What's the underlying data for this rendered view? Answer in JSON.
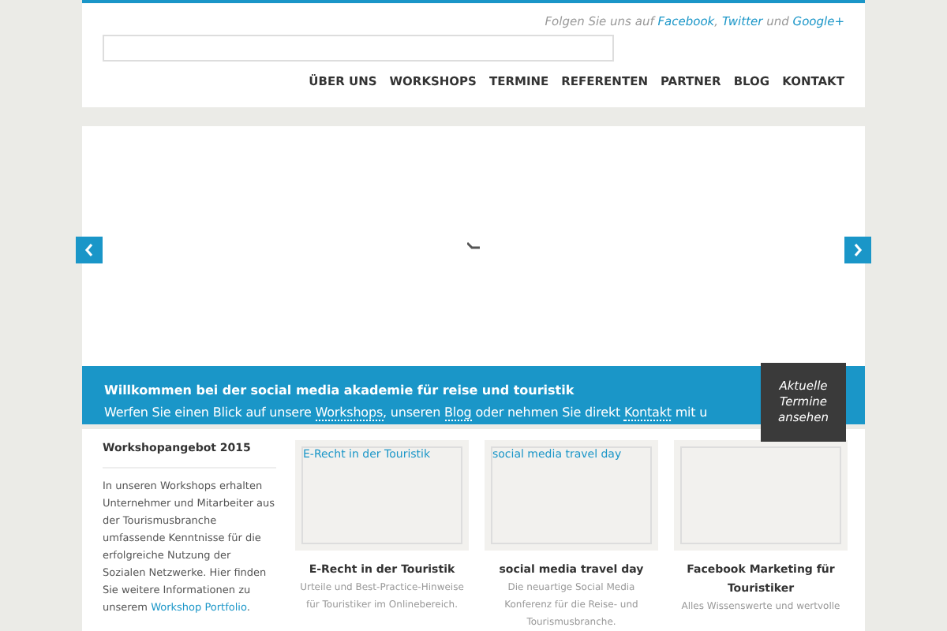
{
  "header": {
    "follow": [
      {
        "text": "Folgen Sie uns auf ",
        "link": false
      },
      {
        "text": "Facebook",
        "link": true
      },
      {
        "text": ", ",
        "link": false
      },
      {
        "text": "Twitter",
        "link": true
      },
      {
        "text": " und ",
        "link": false
      },
      {
        "text": "Google+",
        "link": true
      }
    ],
    "nav": [
      "ÜBER UNS",
      "WORKSHOPS",
      "TERMINE",
      "REFERENTEN",
      "PARTNER",
      "BLOG",
      "KONTAKT"
    ]
  },
  "banner": {
    "title": "Willkommen bei der social media akademie für reise und touristik",
    "line": [
      {
        "text": "Werfen Sie einen Blick auf unsere ",
        "link": false
      },
      {
        "text": "Workshops",
        "link": true
      },
      {
        "text": ", unseren ",
        "link": false
      },
      {
        "text": "Blog",
        "link": true
      },
      {
        "text": " oder nehmen Sie direkt ",
        "link": false
      },
      {
        "text": "Kontakt",
        "link": true
      },
      {
        "text": " mit u",
        "link": false
      }
    ],
    "ribbon": "Aktuelle Termine ansehen"
  },
  "sidebar": {
    "title": "Workshopangebot 2015",
    "text": "In unseren Workshops erhalten Unternehmer und Mitarbeiter aus der Tourismusbranche umfassende Kenntnisse für die erfolgreiche Nutzung der Sozialen Netzwerke. Hier finden Sie weitere Informationen zu unserem ",
    "link": "Workshop Portfolio",
    "after": "."
  },
  "cards": [
    {
      "image_alt": "E-Recht in der Touristik",
      "title": "E-Recht in der Touristik",
      "text": "Urteile und Best-Practice-Hinweise für Touristiker im Onlinebereich."
    },
    {
      "image_alt": "social media travel day",
      "title": "social media travel day",
      "text": "Die neuartige Social Media Konferenz für die Reise- und Tourismusbranche."
    },
    {
      "title": "Facebook Marketing für Touristiker",
      "text": "Alles Wissenswerte und wertvolle"
    }
  ]
}
